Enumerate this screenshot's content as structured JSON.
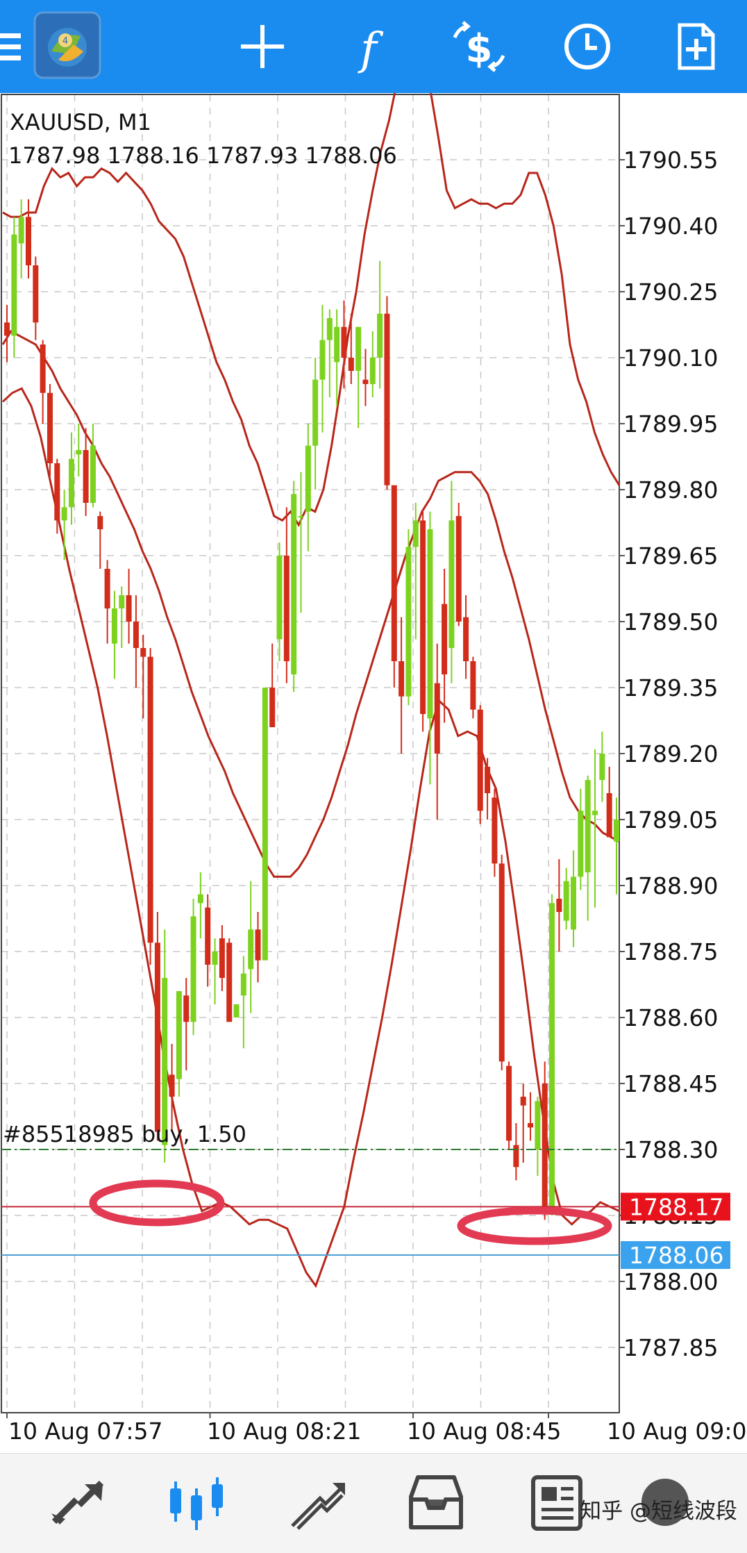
{
  "toolbar": {
    "icons": [
      "menu-icon",
      "metatrader-logo-icon",
      "crosshair-icon",
      "indicator-function-icon",
      "trade-dollar-icon",
      "clock-period-icon",
      "new-order-icon"
    ]
  },
  "chart_data": {
    "type": "candlestick",
    "symbol_timeframe": "XAUUSD, M1",
    "ohlc_text": "1787.98 1788.16 1787.93 1788.06",
    "y_ticks": [
      "1790.55",
      "1790.40",
      "1790.25",
      "1790.10",
      "1789.95",
      "1789.80",
      "1789.65",
      "1789.50",
      "1789.35",
      "1789.20",
      "1789.05",
      "1788.90",
      "1788.75",
      "1788.60",
      "1788.45",
      "1788.30",
      "1788.15",
      "1788.00",
      "1787.85"
    ],
    "x_ticks": [
      "10 Aug 07:57",
      "10 Aug 08:21",
      "10 Aug 08:45",
      "10 Aug 09:0"
    ],
    "order_label": "#85518985 buy, 1.50",
    "order_price": 1788.3,
    "ask_price": "1788.17",
    "bid_price": "1788.06",
    "grid": true,
    "colors": {
      "bull": "#7dd21f",
      "bear": "#d22c1a",
      "band": "#b8261a",
      "ask_tag": "#e8121c",
      "bid_tag": "#3ba3ee",
      "order_line": "#2e7d32",
      "ask_line": "#c8283a",
      "bid_line": "#4a9fd8",
      "highlight": "#e23a52",
      "toolbar_bg": "#1a8cf0"
    },
    "candles": [
      [
        1790.18,
        1790.22,
        1790.09,
        1790.15
      ],
      [
        1790.15,
        1790.42,
        1790.1,
        1790.38
      ],
      [
        1790.36,
        1790.46,
        1790.28,
        1790.42
      ],
      [
        1790.42,
        1790.46,
        1790.28,
        1790.31
      ],
      [
        1790.31,
        1790.33,
        1790.14,
        1790.18
      ],
      [
        1790.13,
        1790.14,
        1789.95,
        1790.02
      ],
      [
        1790.02,
        1790.04,
        1789.83,
        1789.86
      ],
      [
        1789.86,
        1789.87,
        1789.7,
        1789.73
      ],
      [
        1789.73,
        1789.8,
        1789.64,
        1789.76
      ],
      [
        1789.76,
        1789.93,
        1789.72,
        1789.87
      ],
      [
        1789.88,
        1789.95,
        1789.83,
        1789.89
      ],
      [
        1789.89,
        1789.94,
        1789.74,
        1789.77
      ],
      [
        1789.77,
        1789.95,
        1789.76,
        1789.9
      ],
      [
        1789.74,
        1789.75,
        1789.62,
        1789.71
      ],
      [
        1789.62,
        1789.64,
        1789.45,
        1789.53
      ],
      [
        1789.45,
        1789.57,
        1789.37,
        1789.53
      ],
      [
        1789.53,
        1789.58,
        1789.44,
        1789.56
      ],
      [
        1789.56,
        1789.62,
        1789.45,
        1789.5
      ],
      [
        1789.5,
        1789.56,
        1789.35,
        1789.44
      ],
      [
        1789.44,
        1789.47,
        1789.28,
        1789.42
      ],
      [
        1789.42,
        1789.44,
        1788.72,
        1788.77
      ],
      [
        1788.77,
        1788.84,
        1788.32,
        1788.34
      ],
      [
        1788.31,
        1788.8,
        1788.27,
        1788.69
      ],
      [
        1788.47,
        1788.54,
        1788.34,
        1788.42
      ],
      [
        1788.46,
        1788.66,
        1788.42,
        1788.66
      ],
      [
        1788.65,
        1788.69,
        1788.48,
        1788.59
      ],
      [
        1788.59,
        1788.87,
        1788.56,
        1788.83
      ],
      [
        1788.86,
        1788.93,
        1788.78,
        1788.88
      ],
      [
        1788.85,
        1788.88,
        1788.67,
        1788.72
      ],
      [
        1788.72,
        1788.78,
        1788.63,
        1788.75
      ],
      [
        1788.78,
        1788.81,
        1788.66,
        1788.69
      ],
      [
        1788.77,
        1788.78,
        1788.62,
        1788.59
      ],
      [
        1788.6,
        1788.63,
        1788.61,
        1788.63
      ],
      [
        1788.65,
        1788.74,
        1788.53,
        1788.7
      ],
      [
        1788.71,
        1788.91,
        1788.61,
        1788.8
      ],
      [
        1788.8,
        1788.84,
        1788.68,
        1788.73
      ],
      [
        1788.73,
        1789.35,
        1788.73,
        1789.35
      ],
      [
        1789.35,
        1789.45,
        1789.26,
        1789.26
      ],
      [
        1789.46,
        1789.68,
        1789.41,
        1789.65
      ],
      [
        1789.65,
        1789.76,
        1789.36,
        1789.41
      ],
      [
        1789.38,
        1789.82,
        1789.34,
        1789.79
      ],
      [
        1789.74,
        1789.84,
        1789.52,
        1789.74
      ],
      [
        1789.75,
        1789.95,
        1789.66,
        1789.9
      ],
      [
        1789.9,
        1790.1,
        1789.8,
        1790.05
      ],
      [
        1790.05,
        1790.22,
        1789.93,
        1790.14
      ],
      [
        1790.14,
        1790.21,
        1790.01,
        1790.19
      ],
      [
        1790.09,
        1790.21,
        1789.99,
        1790.17
      ],
      [
        1790.17,
        1790.23,
        1790.03,
        1790.1
      ],
      [
        1790.1,
        1790.2,
        1790.04,
        1790.07
      ],
      [
        1790.07,
        1790.17,
        1789.94,
        1790.17
      ],
      [
        1790.05,
        1790.12,
        1789.99,
        1790.04
      ],
      [
        1790.04,
        1790.16,
        1790.01,
        1790.1
      ],
      [
        1790.1,
        1790.32,
        1790.03,
        1790.2
      ],
      [
        1790.2,
        1790.24,
        1789.8,
        1789.81
      ],
      [
        1789.81,
        1789.81,
        1789.35,
        1789.41
      ],
      [
        1789.41,
        1789.51,
        1789.2,
        1789.33
      ],
      [
        1789.33,
        1789.71,
        1789.31,
        1789.67
      ],
      [
        1789.67,
        1789.77,
        1789.46,
        1789.73
      ],
      [
        1789.73,
        1789.75,
        1789.25,
        1789.29
      ],
      [
        1789.28,
        1789.75,
        1789.13,
        1789.71
      ],
      [
        1789.36,
        1789.45,
        1789.05,
        1789.2
      ],
      [
        1789.54,
        1789.62,
        1789.27,
        1789.38
      ],
      [
        1789.44,
        1789.82,
        1789.36,
        1789.73
      ],
      [
        1789.74,
        1789.77,
        1789.49,
        1789.5
      ],
      [
        1789.51,
        1789.56,
        1789.37,
        1789.41
      ],
      [
        1789.41,
        1789.42,
        1789.28,
        1789.3
      ],
      [
        1789.3,
        1789.31,
        1789.04,
        1789.07
      ],
      [
        1789.17,
        1789.19,
        1789.05,
        1789.11
      ],
      [
        1789.1,
        1789.12,
        1788.92,
        1788.95
      ],
      [
        1788.95,
        1788.97,
        1788.48,
        1788.5
      ],
      [
        1788.49,
        1788.5,
        1788.3,
        1788.32
      ],
      [
        1788.31,
        1788.36,
        1788.23,
        1788.26
      ],
      [
        1788.42,
        1788.45,
        1788.27,
        1788.4
      ],
      [
        1788.36,
        1788.43,
        1788.32,
        1788.35
      ],
      [
        1788.3,
        1788.42,
        1788.24,
        1788.41
      ],
      [
        1788.45,
        1788.5,
        1788.14,
        1788.17
      ],
      [
        1788.16,
        1788.88,
        1788.15,
        1788.86
      ],
      [
        1788.87,
        1788.96,
        1788.75,
        1788.84
      ],
      [
        1788.82,
        1788.94,
        1788.8,
        1788.91
      ],
      [
        1788.8,
        1788.98,
        1788.76,
        1788.92
      ],
      [
        1788.92,
        1789.12,
        1788.89,
        1789.07
      ],
      [
        1788.93,
        1789.15,
        1788.82,
        1789.14
      ],
      [
        1789.06,
        1789.21,
        1788.85,
        1789.07
      ],
      [
        1789.14,
        1789.25,
        1789.09,
        1789.2
      ],
      [
        1789.11,
        1789.17,
        1789.03,
        1789.01
      ],
      [
        1789.0,
        1789.1,
        1788.88,
        1789.05
      ]
    ],
    "bb_upper": [
      1790.43,
      1790.42,
      1790.42,
      1790.43,
      1790.43,
      1790.49,
      1790.53,
      1790.51,
      1790.52,
      1790.49,
      1790.51,
      1790.51,
      1790.53,
      1790.52,
      1790.5,
      1790.52,
      1790.5,
      1790.48,
      1790.45,
      1790.41,
      1790.39,
      1790.37,
      1790.33,
      1790.27,
      1790.21,
      1790.15,
      1790.09,
      1790.05,
      1790.0,
      1789.96,
      1789.9,
      1789.86,
      1789.8,
      1789.74,
      1789.73,
      1789.75,
      1789.72,
      1789.76,
      1789.75,
      1789.8,
      1789.9,
      1790.02,
      1790.15,
      1790.25,
      1790.38,
      1790.48,
      1790.57,
      1790.64,
      1790.73,
      1790.8,
      1790.83,
      1790.79,
      1790.71,
      1790.6,
      1790.48,
      1790.44,
      1790.45,
      1790.46,
      1790.45,
      1790.45,
      1790.44,
      1790.45,
      1790.45,
      1790.47,
      1790.52,
      1790.52,
      1790.47,
      1790.4,
      1790.29,
      1790.13,
      1790.05,
      1790.0,
      1789.93,
      1789.88,
      1789.84,
      1789.81
    ],
    "bb_mid": [
      1790.13,
      1790.16,
      1790.15,
      1790.14,
      1790.13,
      1790.1,
      1790.07,
      1790.03,
      1790.0,
      1789.97,
      1789.93,
      1789.9,
      1789.86,
      1789.83,
      1789.79,
      1789.75,
      1789.71,
      1789.66,
      1789.62,
      1789.57,
      1789.51,
      1789.46,
      1789.4,
      1789.34,
      1789.29,
      1789.24,
      1789.2,
      1789.16,
      1789.11,
      1789.07,
      1789.03,
      1788.99,
      1788.95,
      1788.92,
      1788.92,
      1788.92,
      1788.94,
      1788.97,
      1789.01,
      1789.05,
      1789.1,
      1789.16,
      1789.22,
      1789.29,
      1789.35,
      1789.41,
      1789.47,
      1789.53,
      1789.59,
      1789.65,
      1789.7,
      1789.75,
      1789.78,
      1789.82,
      1789.83,
      1789.84,
      1789.84,
      1789.84,
      1789.82,
      1789.79,
      1789.73,
      1789.66,
      1789.6,
      1789.53,
      1789.46,
      1789.38,
      1789.3,
      1789.23,
      1789.16,
      1789.1,
      1789.07,
      1789.05,
      1789.04,
      1789.02,
      1789.01,
      1789.0
    ],
    "bb_lower": [
      1790.0,
      1790.02,
      1790.03,
      1789.99,
      1789.92,
      1789.82,
      1789.72,
      1789.62,
      1789.53,
      1789.44,
      1789.35,
      1789.24,
      1789.12,
      1789.0,
      1788.88,
      1788.76,
      1788.64,
      1788.51,
      1788.4,
      1788.3,
      1788.22,
      1788.16,
      1788.17,
      1788.18,
      1788.17,
      1788.15,
      1788.13,
      1788.14,
      1788.14,
      1788.13,
      1788.12,
      1788.07,
      1788.02,
      1787.99,
      1788.05,
      1788.11,
      1788.17,
      1788.28,
      1788.38,
      1788.49,
      1788.6,
      1788.72,
      1788.85,
      1788.98,
      1789.12,
      1789.25,
      1789.32,
      1789.3,
      1789.24,
      1789.25,
      1789.24,
      1789.17,
      1789.12,
      1789.0,
      1788.85,
      1788.69,
      1788.52,
      1788.37,
      1788.23,
      1788.15,
      1788.13,
      1788.15,
      1788.16,
      1788.18,
      1788.17,
      1788.16
    ]
  },
  "bottom_nav": {
    "items": [
      "quotes-icon",
      "chart-icon",
      "trade-icon",
      "history-icon",
      "news-icon",
      "settings-icon"
    ],
    "watermark": "知乎 @短线波段"
  }
}
